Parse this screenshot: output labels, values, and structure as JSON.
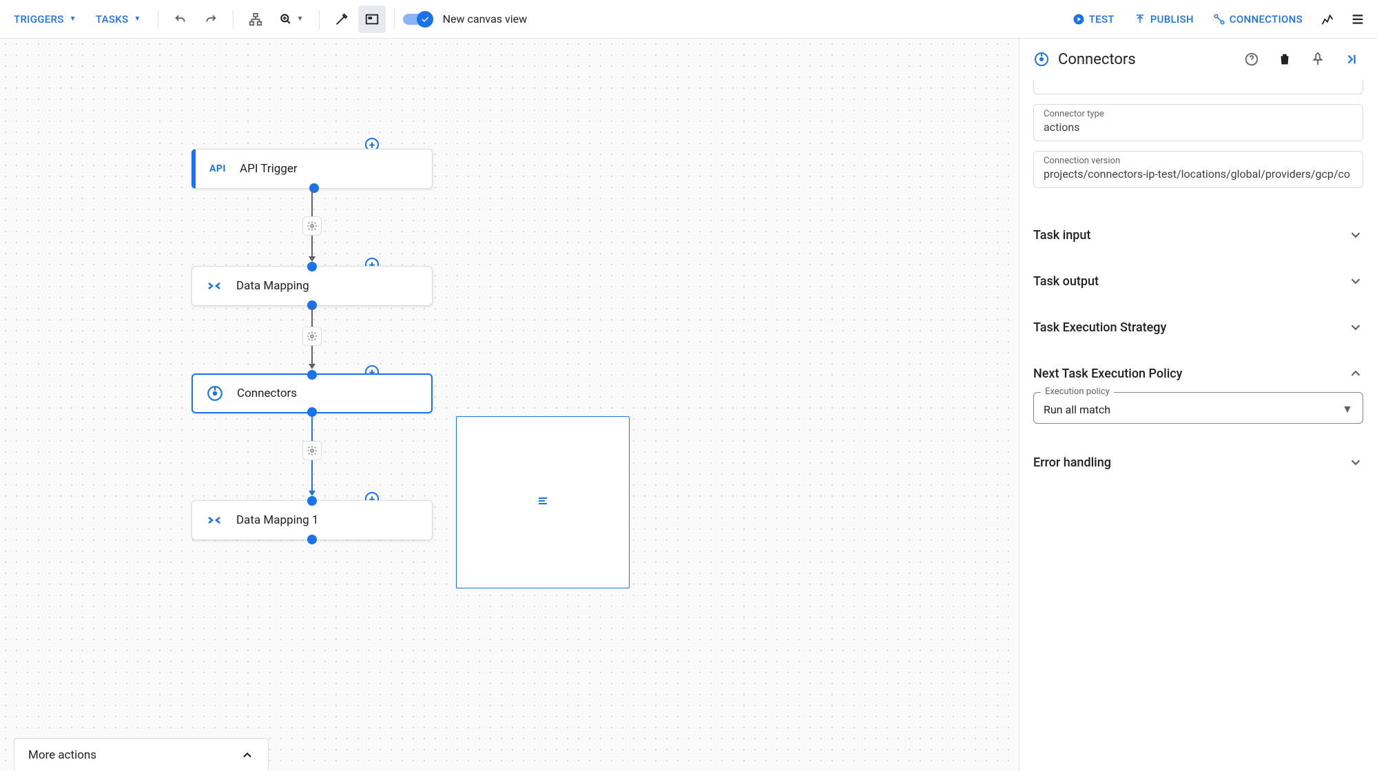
{
  "toolbar": {
    "triggers_label": "TRIGGERS",
    "tasks_label": "TASKS",
    "new_canvas_label": "New canvas view",
    "test_label": "TEST",
    "publish_label": "PUBLISH",
    "connections_label": "CONNECTIONS"
  },
  "nodes": {
    "api_trigger": {
      "label": "API Trigger",
      "icon_text": "API"
    },
    "data_mapping": {
      "label": "Data Mapping"
    },
    "connectors": {
      "label": "Connectors"
    },
    "data_mapping_1": {
      "label": "Data Mapping 1"
    }
  },
  "more_actions_label": "More actions",
  "sidebar": {
    "title": "Connectors",
    "connector_type": {
      "label": "Connector type",
      "value": "actions"
    },
    "connection_version": {
      "label": "Connection version",
      "value": "projects/connectors-ip-test/locations/global/providers/gcp/co"
    },
    "sections": {
      "task_input": "Task input",
      "task_output": "Task output",
      "task_exec_strategy": "Task Execution Strategy",
      "next_task_policy": "Next Task Execution Policy",
      "error_handling": "Error handling"
    },
    "execution_policy": {
      "label": "Execution policy",
      "value": "Run all match"
    }
  }
}
